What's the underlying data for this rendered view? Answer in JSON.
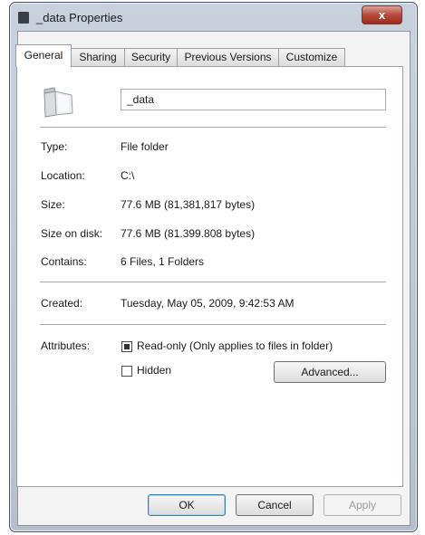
{
  "window": {
    "title": "_data Properties",
    "close_label": "x"
  },
  "tabs": [
    {
      "label": "General"
    },
    {
      "label": "Sharing"
    },
    {
      "label": "Security"
    },
    {
      "label": "Previous Versions"
    },
    {
      "label": "Customize"
    }
  ],
  "general": {
    "name_value": "_data",
    "type_label": "Type:",
    "type_value": "File folder",
    "location_label": "Location:",
    "location_value": "C:\\",
    "size_label": "Size:",
    "size_value": "77.6 MB (81,381,817 bytes)",
    "size_on_disk_label": "Size on disk:",
    "size_on_disk_value": "77.6 MB (81.399.808 bytes)",
    "contains_label": "Contains:",
    "contains_value": "6 Files, 1 Folders",
    "created_label": "Created:",
    "created_value": "Tuesday, May 05, 2009, 9:42:53 AM",
    "attributes_label": "Attributes:",
    "readonly_label": "Read-only (Only applies to files in folder)",
    "hidden_label": "Hidden",
    "advanced_label": "Advanced..."
  },
  "buttons": {
    "ok": "OK",
    "cancel": "Cancel",
    "apply": "Apply"
  },
  "icons": {
    "title": "folder-icon",
    "close": "close-icon",
    "folder": "folder-icon"
  }
}
